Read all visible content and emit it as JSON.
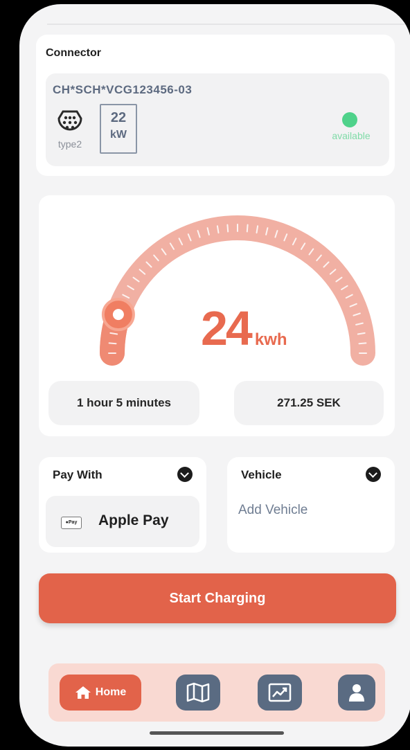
{
  "connector": {
    "title": "Connector",
    "id": "CH*SCH*VCG123456-03",
    "plug_icon": "type2-plug-icon",
    "plug_label": "type2",
    "power_value": "22",
    "power_unit": "kW",
    "status": "available",
    "status_color": "#4fd28a"
  },
  "session": {
    "energy_value": "24",
    "energy_unit": "kwh",
    "gauge_level": 0.1,
    "duration": "1 hour 5 minutes",
    "cost": "271.25 SEK"
  },
  "payment": {
    "title": "Pay With",
    "method": "Apple Pay",
    "method_icon": "apple-pay-icon",
    "method_icon_text": "●Pay"
  },
  "vehicle": {
    "title": "Vehicle",
    "placeholder": "Add Vehicle"
  },
  "actions": {
    "start": "Start Charging"
  },
  "nav": {
    "home": "Home",
    "items": [
      "home-icon",
      "map-icon",
      "chart-icon",
      "profile-icon"
    ]
  },
  "colors": {
    "accent": "#e2634a",
    "nav_bg": "#f9d9d2",
    "nav_button": "#5a6b82"
  }
}
